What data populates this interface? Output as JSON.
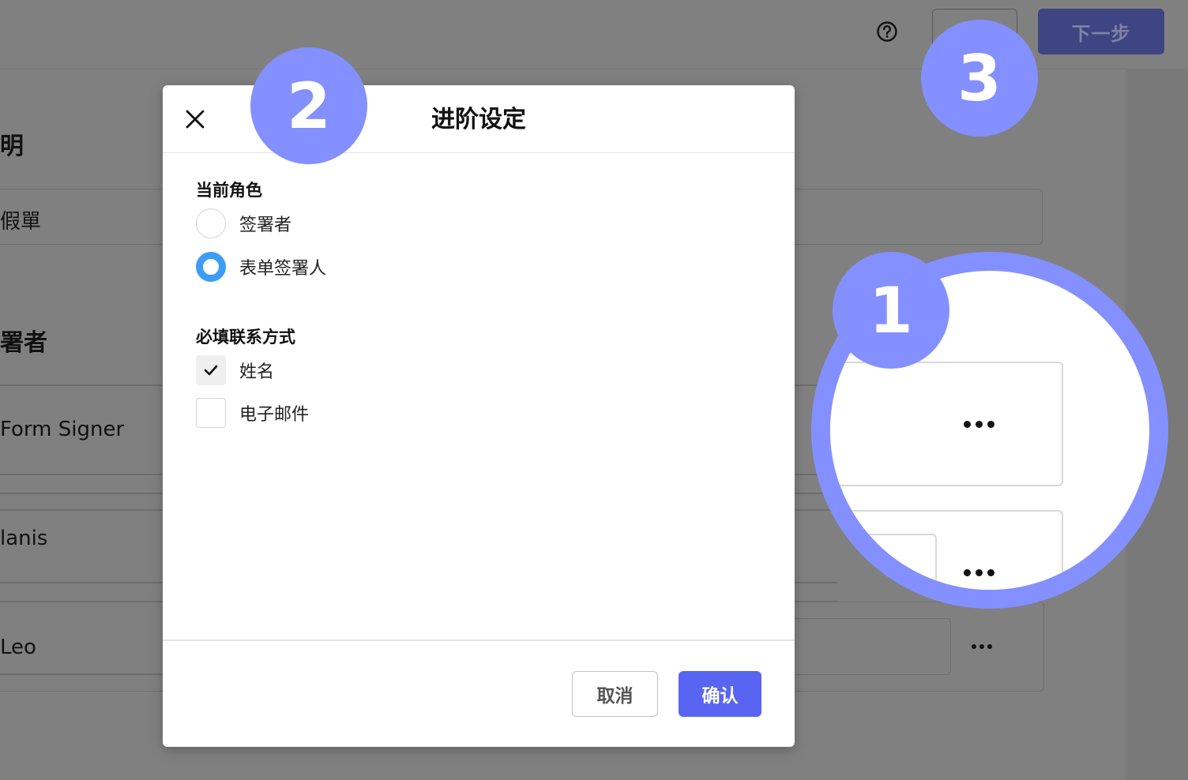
{
  "header": {
    "help_icon": "question-circle-icon",
    "next_label": "下一步"
  },
  "background": {
    "heading_1": "明",
    "field_1_value": "假單",
    "heading_2": "署者",
    "signers": [
      "Form Signer",
      "lanis",
      "Leo"
    ]
  },
  "dialog": {
    "title": "进阶设定",
    "close_icon": "close-icon",
    "role_section": {
      "label": "当前角色",
      "options": [
        {
          "label": "签署者",
          "selected": false
        },
        {
          "label": "表单签署人",
          "selected": true
        }
      ]
    },
    "contact_section": {
      "label": "必填联系方式",
      "options": [
        {
          "label": "姓名",
          "checked": true
        },
        {
          "label": "电子邮件",
          "checked": false
        }
      ]
    },
    "cancel_label": "取消",
    "confirm_label": "确认"
  },
  "annotations": {
    "steps": [
      "1",
      "2",
      "3"
    ],
    "accent_color": "#8490ff",
    "magnifier_icon": "more-options-icon"
  },
  "colors": {
    "primary": "#5865f2",
    "radio_selected": "#3d9df5",
    "overlay": "#808080"
  }
}
